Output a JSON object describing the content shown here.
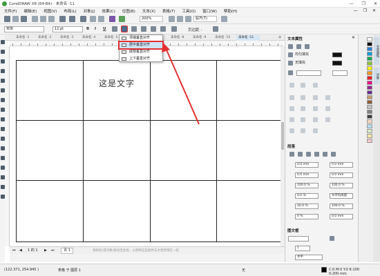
{
  "window": {
    "title": "CorelDRAW X8 (64-Bit) - 未命名 -11",
    "minimize": "—",
    "restore": "❐",
    "close": "✕"
  },
  "menu": {
    "items": [
      "文件(F)",
      "编辑(E)",
      "视图(V)",
      "布局(L)",
      "对象(J)",
      "效果(C)",
      "位图(B)",
      "文本(X)",
      "表格(T)",
      "工具(O)",
      "窗口(W)",
      "帮助(H)"
    ],
    "doc_min": "—",
    "doc_restore": "❐",
    "doc_close": "✕"
  },
  "toolbar1": {
    "zoom": "200%",
    "snap_label": "贴齐(T)",
    "launch_label": "▾"
  },
  "toolbar2": {
    "font_name": "宋体",
    "font_size": "12 pt",
    "bold": "B",
    "italic": "I",
    "underline": "U",
    "page_border": "页边距 :"
  },
  "tabs": [
    "未命名 -1",
    "未命名 -2",
    "未命名 -3",
    "未命名 -4",
    "未命名 -5",
    "未命名 -6",
    "未命名 -7",
    "未命名 -8",
    "未命名 -9",
    "未命名 -10",
    "未命名 -11"
  ],
  "tab_add": "+",
  "dropdown": {
    "items": [
      {
        "label": "顶端垂直对齐"
      },
      {
        "label": "居中垂直对齐"
      },
      {
        "label": "底部垂直对齐"
      },
      {
        "label": "上下垂直对齐"
      }
    ],
    "highlighted_index": 1
  },
  "canvas": {
    "cell_text": "这是文字"
  },
  "pagebar": {
    "page_info": "1 的 1",
    "page_tab": "页 1",
    "hint": "将颜色(或对象)拖动至此处，以便将这些颜色与文档存储在一起"
  },
  "statusbar": {
    "coords": "(122.371, 254.945 )",
    "layer": "表格 于 图层 1",
    "fill_none": "无",
    "outline": "C:0 M:0 Y:0 K:100",
    "outline_width": "0.200 mm"
  },
  "panel": {
    "title": "文本属性",
    "close": "✕",
    "fill_label": "均匀填充",
    "bg_fill_label": "无填充",
    "section_paragraph": "段落",
    "field1": "0.0 mm",
    "field2": "0.0 mm",
    "field3": "0.0 mm",
    "field4": "0.0 mm",
    "field5": "100.0 %",
    "field6": "100.0 %",
    "field7": "0.0 %",
    "field8": "%字符高度",
    "field9": "20.0 %",
    "field10": "100.0 %",
    "field11": "0 %",
    "field12": "0.0 mm",
    "section_frame": "图文框",
    "columns": "1",
    "direction": "水平"
  },
  "palette_colors": [
    "#ffffff",
    "#000000",
    "#2a7fd4",
    "#00a0e0",
    "#00a651",
    "#8dc63f",
    "#fff200",
    "#f7941d",
    "#ed1c24",
    "#ec008c",
    "#92278f",
    "#662d91",
    "#c69c6d",
    "#8b5e3c",
    "#c0c0c0",
    "#808080",
    "#404040",
    "#f9d7c4",
    "#b3dff2",
    "#d6e9c6",
    "#fce3a0",
    "#f5c6cb"
  ],
  "right_tabs": [
    "文本属性",
    "对象"
  ],
  "colors": {
    "highlight_border": "#e23030",
    "arrow": "#e23030",
    "menu_highlight": "#cfe3f7"
  }
}
